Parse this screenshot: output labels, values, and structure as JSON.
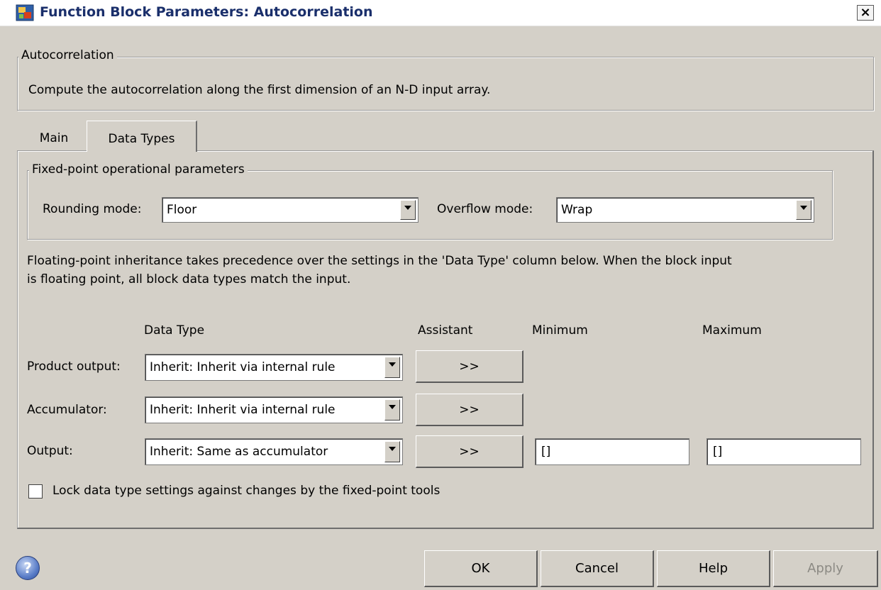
{
  "window": {
    "title": "Function Block Parameters: Autocorrelation",
    "close_glyph": "×"
  },
  "block": {
    "group_label": "Autocorrelation",
    "description": "Compute the autocorrelation along the first dimension of an N-D input array."
  },
  "tabs": [
    {
      "label": "Main",
      "selected": false
    },
    {
      "label": "Data Types",
      "selected": true
    }
  ],
  "fixed_point": {
    "group_label": "Fixed-point operational parameters",
    "rounding_label": "Rounding mode:",
    "rounding_value": "Floor",
    "overflow_label": "Overflow mode:",
    "overflow_value": "Wrap"
  },
  "note": {
    "line1": "Floating-point inheritance takes precedence over the settings in the 'Data Type' column below. When the block input",
    "line2": "is floating point, all block data types match the input."
  },
  "table": {
    "headers": {
      "data_type": "Data Type",
      "assistant": "Assistant",
      "minimum": "Minimum",
      "maximum": "Maximum"
    },
    "rows": [
      {
        "label": "Product output:",
        "data_type": "Inherit: Inherit via internal rule",
        "assistant": ">>"
      },
      {
        "label": "Accumulator:",
        "data_type": "Inherit: Inherit via internal rule",
        "assistant": ">>"
      },
      {
        "label": "Output:",
        "data_type": "Inherit: Same as accumulator",
        "assistant": ">>",
        "minimum": "[]",
        "maximum": "[]"
      }
    ]
  },
  "lock": {
    "label": "Lock data type settings against changes by the fixed-point tools",
    "checked": false
  },
  "buttons": {
    "help_icon": "?",
    "ok": "OK",
    "cancel": "Cancel",
    "help": "Help",
    "apply": "Apply"
  },
  "icons": {
    "app": "simulink-block-icon",
    "help": "help-question-icon",
    "close": "close-icon",
    "dropdown": "chevron-down-icon"
  }
}
